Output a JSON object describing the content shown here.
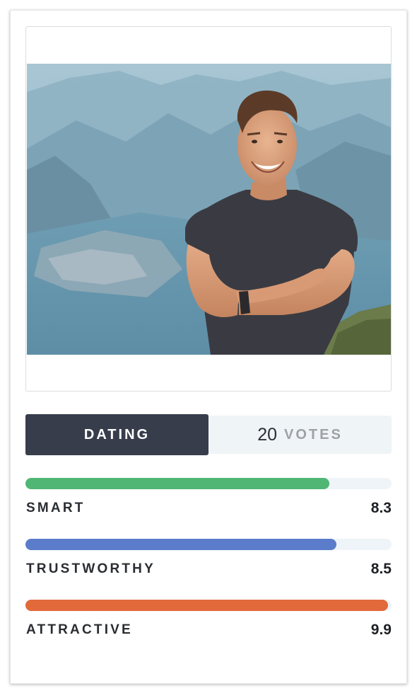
{
  "profile": {
    "photo_alt": "Smiling man with crossed arms in front of a mountain lake"
  },
  "stats": {
    "category_label": "DATING",
    "votes_count": "20",
    "votes_label": "VOTES"
  },
  "metrics": [
    {
      "label": "SMART",
      "value": "8.3",
      "level": 0.83,
      "color": "#4fb674"
    },
    {
      "label": "TRUSTWORTHY",
      "value": "8.5",
      "level": 0.85,
      "color": "#5a7ccb"
    },
    {
      "label": "ATTRACTIVE",
      "value": "9.9",
      "level": 0.99,
      "color": "#e2693a"
    }
  ]
}
